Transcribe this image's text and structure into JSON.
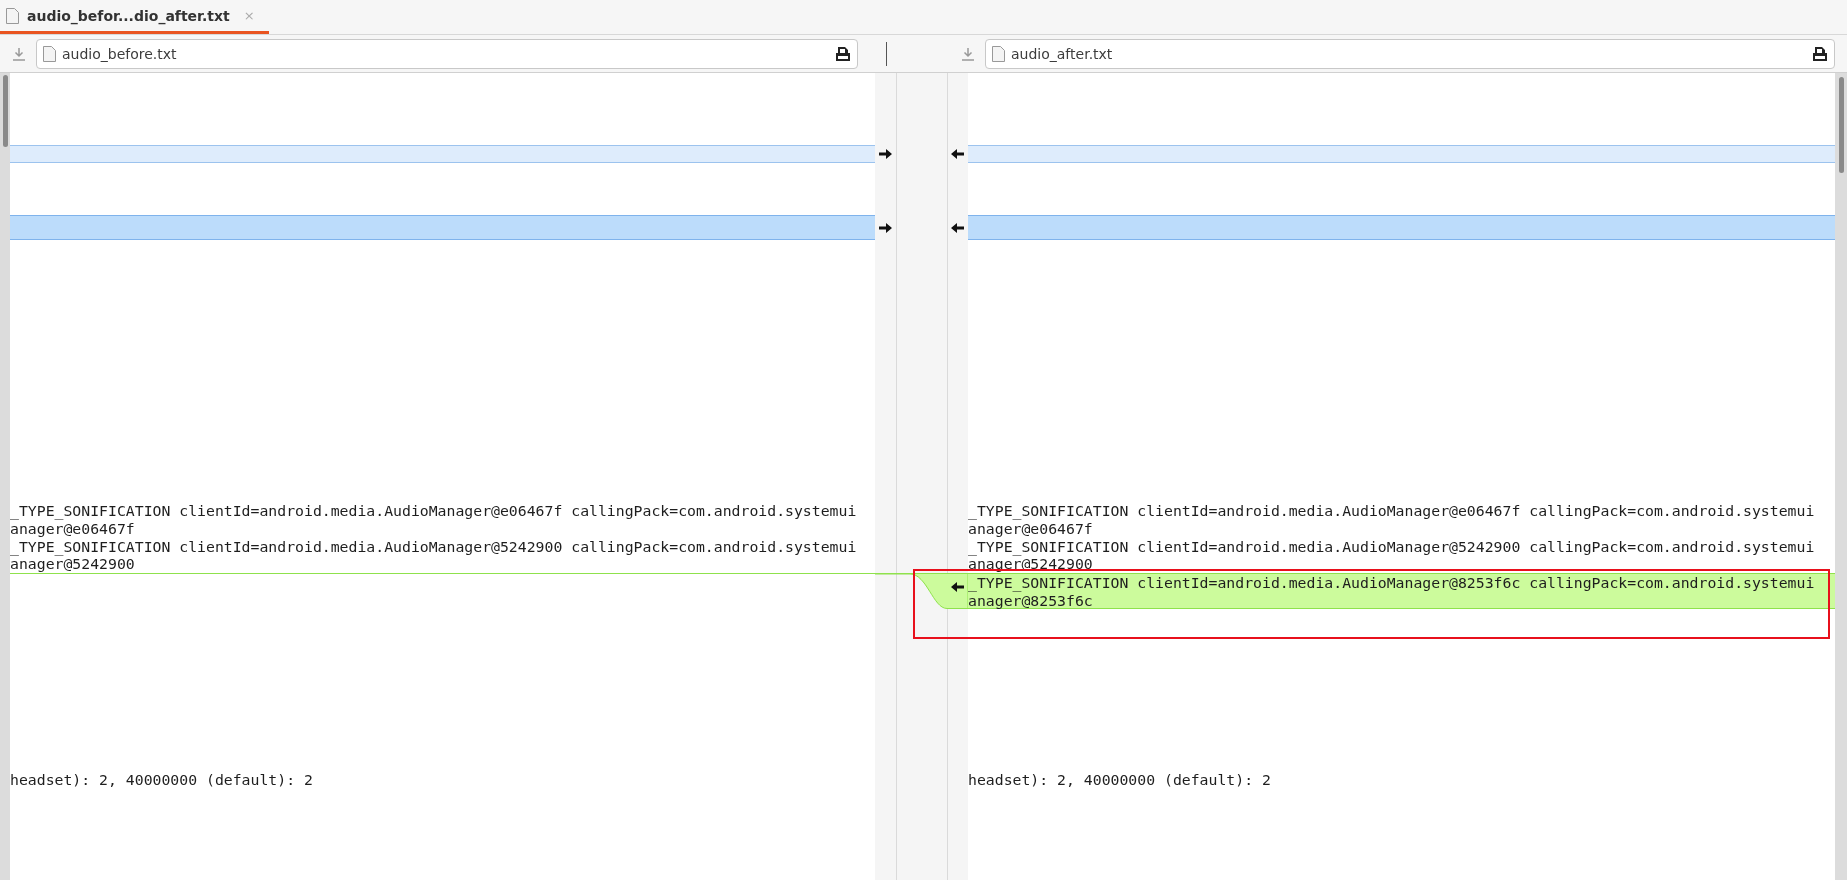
{
  "tab": {
    "title": "audio_befor...dio_after.txt",
    "close": "×",
    "selected": true
  },
  "files": [
    {
      "name": "audio_before.txt"
    },
    {
      "name": "audio_after.txt"
    }
  ],
  "rows": [
    {
      "kind": "change",
      "selected": false
    },
    {
      "kind": "change",
      "selected": true
    },
    {
      "kind": "context",
      "left": [
        "_TYPE_SONIFICATION clientId=android.media.AudioManager@e06467f callingPack=com.android.systemui",
        "anager@e06467f",
        "_TYPE_SONIFICATION clientId=android.media.AudioManager@5242900 callingPack=com.android.systemui",
        "anager@5242900"
      ],
      "right": [
        "_TYPE_SONIFICATION clientId=android.media.AudioManager@e06467f callingPack=com.android.systemui",
        "anager@e06467f",
        "_TYPE_SONIFICATION clientId=android.media.AudioManager@5242900 callingPack=com.android.systemui",
        "anager@5242900"
      ]
    },
    {
      "kind": "insert",
      "right": [
        "_TYPE_SONIFICATION clientId=android.media.AudioManager@8253f6c callingPack=com.android.systemui",
        "anager@8253f6c"
      ],
      "highlighted": true
    },
    {
      "kind": "context",
      "left": [
        "headset): 2, 40000000 (default): 2"
      ],
      "right": [
        "headset): 2, 40000000 (default): 2"
      ]
    }
  ]
}
